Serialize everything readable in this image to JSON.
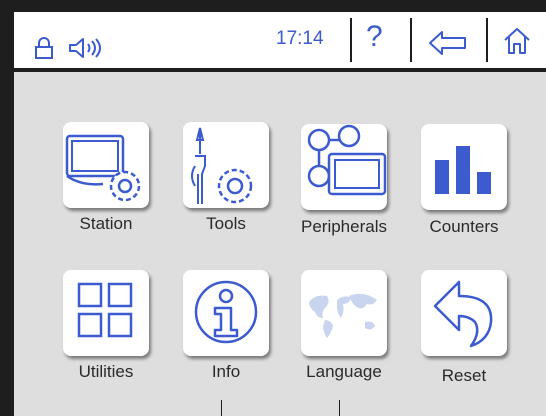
{
  "header": {
    "time": "17:14",
    "help_label": "?",
    "icons": [
      "lock-icon",
      "speaker-icon",
      "back-arrow-icon",
      "home-icon"
    ]
  },
  "tiles": [
    {
      "label": "Station",
      "icon": "station-icon"
    },
    {
      "label": "Tools",
      "icon": "tools-icon"
    },
    {
      "label": "Peripherals",
      "icon": "peripherals-icon"
    },
    {
      "label": "Counters",
      "icon": "counters-icon"
    },
    {
      "label": "Utilities",
      "icon": "utilities-icon"
    },
    {
      "label": "Info",
      "icon": "info-icon"
    },
    {
      "label": "Language",
      "icon": "language-icon"
    },
    {
      "label": "Reset",
      "icon": "reset-icon"
    }
  ],
  "colors": {
    "accent": "#3b5bcf",
    "frame": "#1e1e1e",
    "background": "#dedede"
  }
}
